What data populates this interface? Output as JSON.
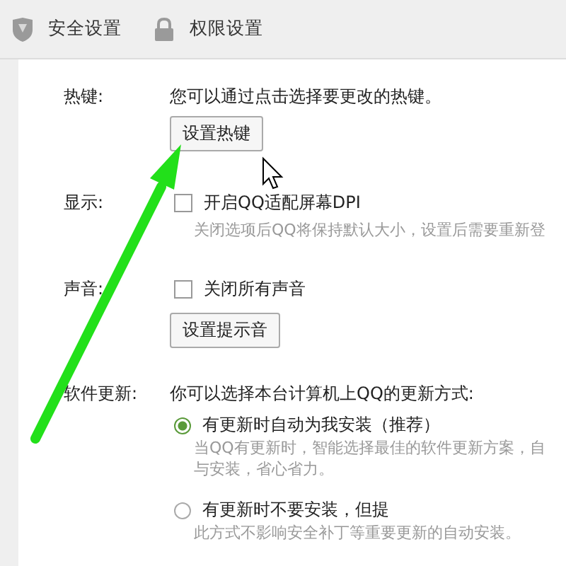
{
  "tabs": [
    {
      "label": "安全设置"
    },
    {
      "label": "权限设置"
    }
  ],
  "hotkey": {
    "label": "热键:",
    "description": "您可以通过点击选择要更改的热键。",
    "button": "设置热键"
  },
  "display": {
    "label": "显示:",
    "checkbox": {
      "label": "开启QQ适配屏幕DPI",
      "checked": false
    },
    "note": "关闭选项后QQ将保持默认大小，设置后需要重新登"
  },
  "sound": {
    "label": "声音:",
    "checkbox": {
      "label": "关闭所有声音",
      "checked": false
    },
    "button": "设置提示音"
  },
  "update": {
    "label": "软件更新:",
    "description": "你可以选择本台计算机上QQ的更新方式:",
    "options": [
      {
        "label": "有更新时自动为我安装（推荐）",
        "selected": true,
        "note": [
          "当QQ有更新时，智能选择最佳的软件更新方案，自",
          "与安装，省心省力。"
        ]
      },
      {
        "label": "有更新时不要安装，但提",
        "selected": false,
        "note": [
          "此方式不影响安全补丁等重要更新的自动安装。"
        ]
      }
    ]
  }
}
